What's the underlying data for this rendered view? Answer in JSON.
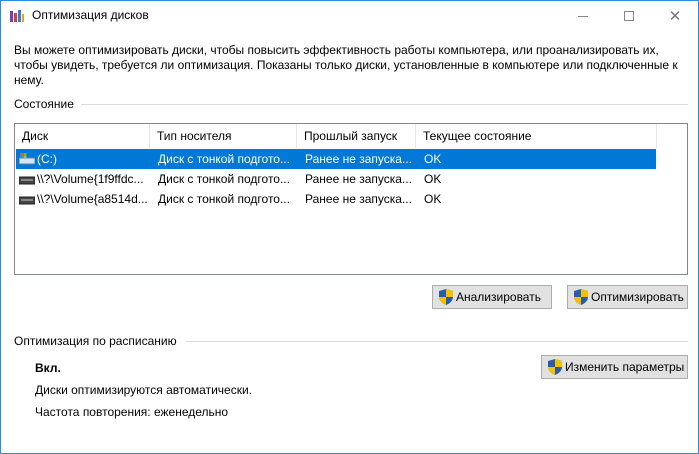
{
  "window": {
    "title": "Оптимизация дисков",
    "controls": {
      "minimize": "",
      "maximize": "",
      "close": "✕"
    }
  },
  "intro": "Вы можете оптимизировать диски, чтобы повысить эффективность работы  компьютера, или проанализировать их, чтобы увидеть, требуется ли оптимизация. Показаны только диски, установленные в компьютере или подключенные к нему.",
  "status": {
    "label": "Состояние",
    "columns": [
      "Диск",
      "Тип носителя",
      "Прошлый запуск",
      "Текущее состояние"
    ],
    "rows": [
      {
        "disk": "(C:)",
        "media": "Диск с тонкой подгото...",
        "last_run": "Ранее не запуска...",
        "state": "OK",
        "selected": true
      },
      {
        "disk": "\\\\?\\Volume{1f9ffdc...",
        "media": "Диск с тонкой подгото...",
        "last_run": "Ранее не запуска...",
        "state": "OK",
        "selected": false
      },
      {
        "disk": "\\\\?\\Volume{a8514d...",
        "media": "Диск с тонкой подгото...",
        "last_run": "Ранее не запуска...",
        "state": "OK",
        "selected": false
      }
    ]
  },
  "buttons": {
    "analyze": "Анализировать",
    "optimize": "Оптимизировать",
    "change_settings": "Изменить параметры"
  },
  "schedule": {
    "label": "Оптимизация по расписанию",
    "state": "Вкл.",
    "description": "Диски оптимизируются автоматически.",
    "frequency": "Частота повторения: еженедельно"
  },
  "colors": {
    "selection": "#0078d7",
    "window_border": "#2b8de0",
    "button_bg": "#e1e1e1"
  }
}
